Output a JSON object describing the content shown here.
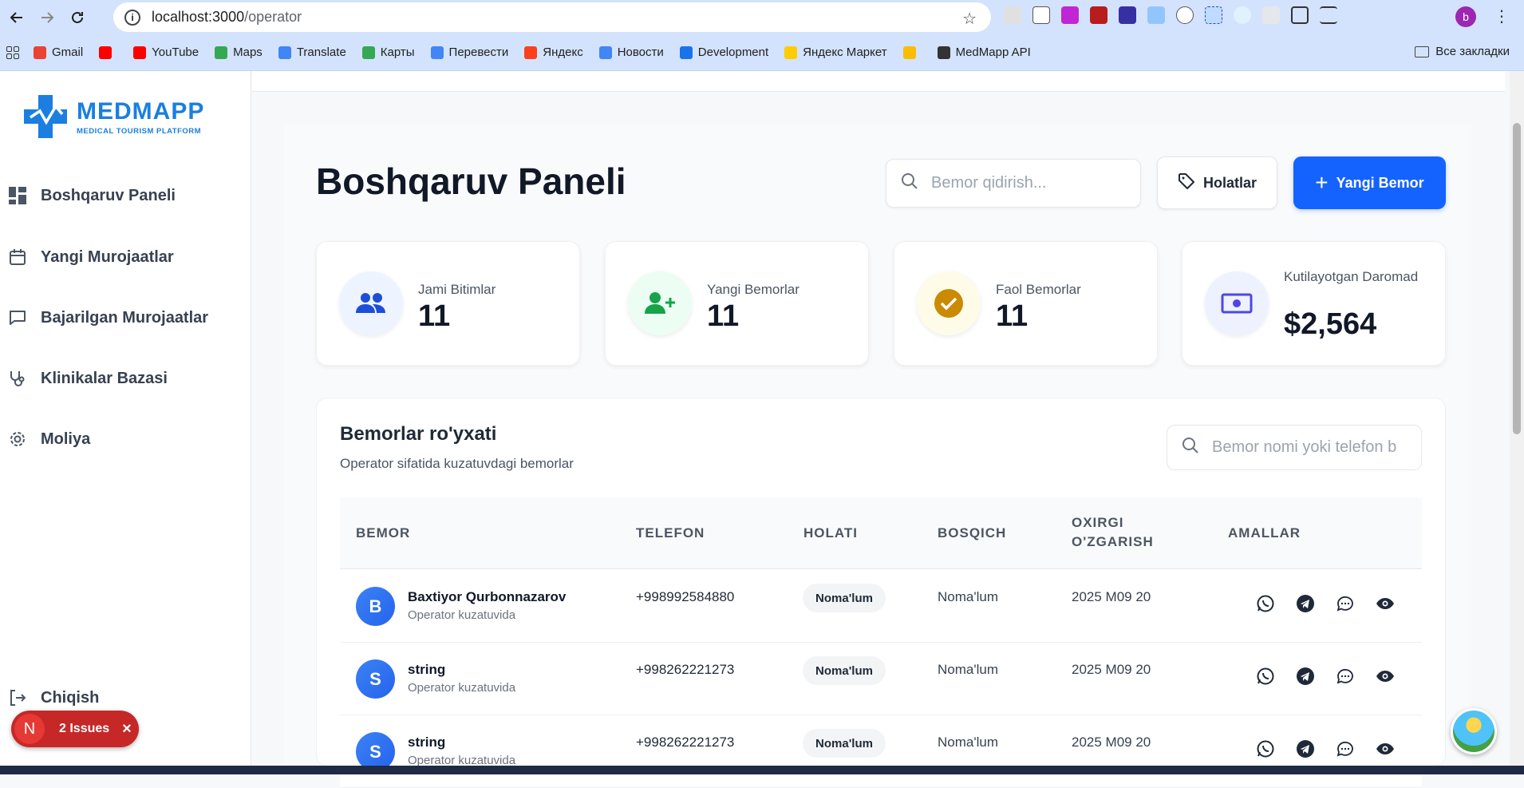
{
  "browser": {
    "url_host": "localhost:3000",
    "url_path": "/operator",
    "bookmarks": [
      {
        "label": "Gmail",
        "color": "#ea4335"
      },
      {
        "label": "",
        "color": "#ff0000"
      },
      {
        "label": "YouTube",
        "color": "#ff0000"
      },
      {
        "label": "Maps",
        "color": "#34a853"
      },
      {
        "label": "Translate",
        "color": "#4285f4"
      },
      {
        "label": "Карты",
        "color": "#34a853"
      },
      {
        "label": "Перевести",
        "color": "#4285f4"
      },
      {
        "label": "Яндекс",
        "color": "#fc3f1d"
      },
      {
        "label": "Новости",
        "color": "#4285f4"
      },
      {
        "label": "Development",
        "color": "#1a73e8"
      },
      {
        "label": "Яндекс Маркет",
        "color": "#ffcc00"
      },
      {
        "label": "",
        "color": "#fbbc04"
      },
      {
        "label": "MedMapp API",
        "color": "#333333"
      }
    ],
    "all_bookmarks": "Все закладки",
    "profile_initial": "b"
  },
  "sidebar": {
    "logo_title": "MEDMAPP",
    "logo_subtitle": "MEDICAL TOURISM PLATFORM",
    "items": [
      {
        "label": "Boshqaruv Paneli",
        "icon": "dashboard-icon"
      },
      {
        "label": "Yangi Murojaatlar",
        "icon": "calendar-icon"
      },
      {
        "label": "Bajarilgan Murojaatlar",
        "icon": "chat-icon"
      },
      {
        "label": "Klinikalar Bazasi",
        "icon": "stethoscope-icon"
      },
      {
        "label": "Moliya",
        "icon": "gear-icon"
      }
    ],
    "logout_label": "Chiqish"
  },
  "issues": {
    "initial": "N",
    "label": "2 Issues"
  },
  "header": {
    "title": "Boshqaruv Paneli",
    "search_placeholder": "Bemor qidirish...",
    "status_button": "Holatlar",
    "new_button": "Yangi Bemor"
  },
  "stats": [
    {
      "label": "Jami Bitimlar",
      "value": "11",
      "icon": "users-icon",
      "color": "#1d4ed8",
      "bg": "#eef4ff"
    },
    {
      "label": "Yangi Bemorlar",
      "value": "11",
      "icon": "user-plus-icon",
      "color": "#16a34a",
      "bg": "#ecfdf3"
    },
    {
      "label": "Faol Bemorlar",
      "value": "11",
      "icon": "check-circle-icon",
      "color": "#ca8a04",
      "bg": "#fefce8"
    },
    {
      "label": "Kutilayotgan Daromad",
      "value": "$2,564",
      "icon": "money-icon",
      "color": "#4f46e5",
      "bg": "#eef2ff"
    }
  ],
  "patients": {
    "title": "Bemorlar ro'yxati",
    "subtitle": "Operator sifatida kuzatuvdagi bemorlar",
    "search_placeholder": "Bemor nomi yoki telefon b",
    "columns": [
      "BEMOR",
      "TELEFON",
      "HOLATI",
      "BOSQICH",
      "OXIRGI O'ZGARISH",
      "AMALLAR"
    ],
    "rows": [
      {
        "initial": "B",
        "name": "Baxtiyor Qurbonnazarov",
        "sub": "Operator kuzatuvida",
        "phone": "+998992584880",
        "status": "Noma'lum",
        "stage": "Noma'lum",
        "date": "2025 M09 20"
      },
      {
        "initial": "S",
        "name": "string",
        "sub": "Operator kuzatuvida",
        "phone": "+998262221273",
        "status": "Noma'lum",
        "stage": "Noma'lum",
        "date": "2025 M09 20"
      },
      {
        "initial": "S",
        "name": "string",
        "sub": "Operator kuzatuvida",
        "phone": "+998262221273",
        "status": "Noma'lum",
        "stage": "Noma'lum",
        "date": "2025 M09 20"
      }
    ]
  }
}
